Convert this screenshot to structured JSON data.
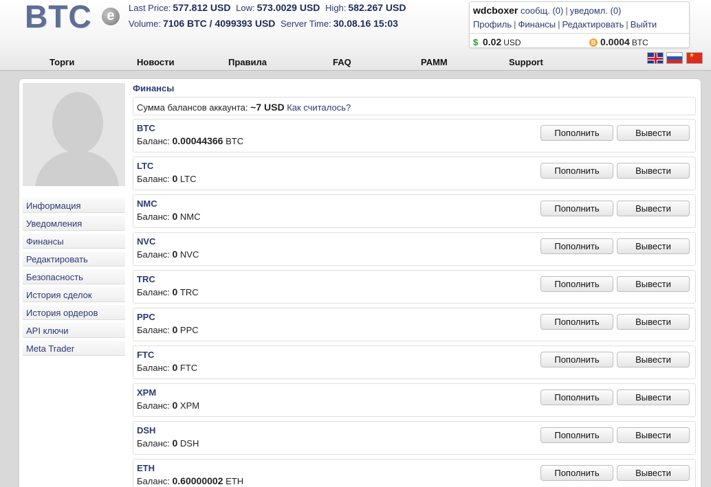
{
  "header": {
    "logo_text": "BTC",
    "logo_badge": "e",
    "ticker": {
      "last_price_label": "Last Price:",
      "last_price": "577.812 USD",
      "low_label": "Low:",
      "low": "573.0029 USD",
      "high_label": "High:",
      "high": "582.267 USD",
      "volume_label": "Volume:",
      "volume": "7106 BTC / 4099393 USD",
      "server_time_label": "Server Time:",
      "server_time": "30.08.16 15:03"
    },
    "user": {
      "username": "wdcboxer",
      "messages": "сообщ. (0)",
      "notifications": "уведомл. (0)",
      "links": [
        "Профиль",
        "Финансы",
        "Редактировать",
        "Выйти"
      ],
      "balance_usd_value": "0.02",
      "balance_usd_unit": "USD",
      "balance_btc_value": "0.0004",
      "balance_btc_unit": "BTC"
    },
    "nav": [
      "Торги",
      "Новости",
      "Правила",
      "FAQ",
      "PAMM",
      "Support"
    ],
    "languages": [
      "English",
      "Русский",
      "中文"
    ]
  },
  "sidebar": {
    "menu": [
      "Информация",
      "Уведомления",
      "Финансы",
      "Редактировать",
      "Безопасность",
      "История сделок",
      "История ордеров",
      "API ключи",
      "Meta Trader"
    ]
  },
  "main": {
    "title": "Финансы",
    "sum_label": "Сумма балансов аккаунта:",
    "sum_value": "~7 USD",
    "sum_link": "Как считалось?",
    "balance_label": "Баланс:",
    "deposit_label": "Пополнить",
    "withdraw_label": "Вывести",
    "currencies": [
      {
        "code": "BTC",
        "balance": "0.00044366",
        "unit": "BTC"
      },
      {
        "code": "LTC",
        "balance": "0",
        "unit": "LTC"
      },
      {
        "code": "NMC",
        "balance": "0",
        "unit": "NMC"
      },
      {
        "code": "NVC",
        "balance": "0",
        "unit": "NVC"
      },
      {
        "code": "TRC",
        "balance": "0",
        "unit": "TRC"
      },
      {
        "code": "PPC",
        "balance": "0",
        "unit": "PPC"
      },
      {
        "code": "FTC",
        "balance": "0",
        "unit": "FTC"
      },
      {
        "code": "XPM",
        "balance": "0",
        "unit": "XPM"
      },
      {
        "code": "DSH",
        "balance": "0",
        "unit": "DSH"
      },
      {
        "code": "ETH",
        "balance": "0.60000002",
        "unit": "ETH"
      }
    ]
  },
  "colors": {
    "link": "#2b3a76",
    "logo": "#5f6e95",
    "background": "#d9d9d9"
  }
}
